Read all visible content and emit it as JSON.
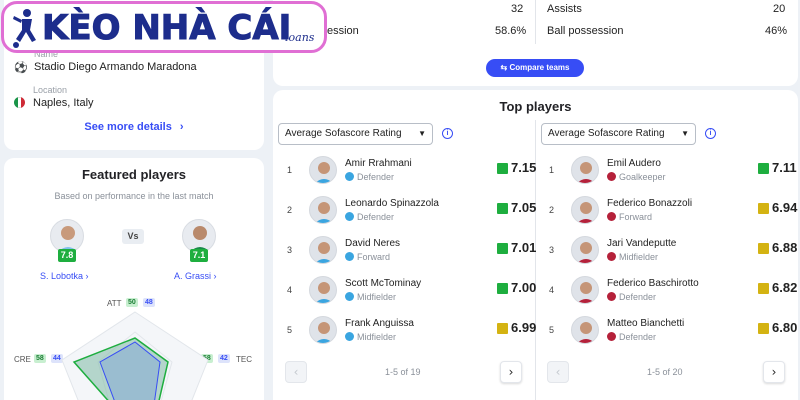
{
  "logo": {
    "brand": "KÈO NHÀ CÁI",
    "sub": "loans"
  },
  "venue": {
    "name_label": "Name",
    "name_value": "Stadio Diego Armando Maradona",
    "location_label": "Location",
    "location_value": "Naples, Italy",
    "see_more": "See more details",
    "flag_colors": [
      "#1a9448",
      "#ffffff",
      "#ce2b37"
    ]
  },
  "featured": {
    "title": "Featured players",
    "subtitle": "Based on performance in the last match",
    "vs": "Vs",
    "left": {
      "rating": "7.8",
      "name": "S. Lobotka"
    },
    "right": {
      "rating": "7.1",
      "name": "A. Grassi"
    },
    "attributes": {
      "att": {
        "label": "ATT",
        "a": "50",
        "b": "48"
      },
      "cre": {
        "label": "CRE",
        "a": "58",
        "b": "44"
      },
      "tec": {
        "label": "TEC",
        "a": "58",
        "b": "42"
      }
    }
  },
  "stats": {
    "left_value_1": "32",
    "right_label_1": "Assists",
    "right_value_1": "20",
    "left_label_2": "ession",
    "left_value_2": "58.6%",
    "right_label_2": "Ball possession",
    "right_value_2": "46%",
    "compare_button": "Compare teams"
  },
  "top_players": {
    "title": "Top players",
    "select_label": "Average Sofascore Rating",
    "home": {
      "crest_color": "#3aa5e0",
      "players": [
        {
          "rank": "1",
          "name": "Amir Rrahmani",
          "position": "Defender",
          "rating": "7.15",
          "color": "#1eae3f"
        },
        {
          "rank": "2",
          "name": "Leonardo Spinazzola",
          "position": "Defender",
          "rating": "7.05",
          "color": "#1eae3f"
        },
        {
          "rank": "3",
          "name": "David Neres",
          "position": "Forward",
          "rating": "7.01",
          "color": "#1eae3f"
        },
        {
          "rank": "4",
          "name": "Scott McTominay",
          "position": "Midfielder",
          "rating": "7.00",
          "color": "#1eae3f"
        },
        {
          "rank": "5",
          "name": "Frank Anguissa",
          "position": "Midfielder",
          "rating": "6.99",
          "color": "#d4b312"
        }
      ],
      "pager": "1-5 of 19"
    },
    "away": {
      "crest_color": "#b5213a",
      "players": [
        {
          "rank": "1",
          "name": "Emil Audero",
          "position": "Goalkeeper",
          "rating": "7.11",
          "color": "#1eae3f"
        },
        {
          "rank": "2",
          "name": "Federico Bonazzoli",
          "position": "Forward",
          "rating": "6.94",
          "color": "#d4b312"
        },
        {
          "rank": "3",
          "name": "Jari Vandeputte",
          "position": "Midfielder",
          "rating": "6.88",
          "color": "#d4b312"
        },
        {
          "rank": "4",
          "name": "Federico Baschirotto",
          "position": "Defender",
          "rating": "6.82",
          "color": "#d4b312"
        },
        {
          "rank": "5",
          "name": "Matteo Bianchetti",
          "position": "Defender",
          "rating": "6.80",
          "color": "#d4b312"
        }
      ],
      "pager": "1-5 of 20"
    },
    "pager_prev": "‹",
    "pager_next": "›"
  }
}
